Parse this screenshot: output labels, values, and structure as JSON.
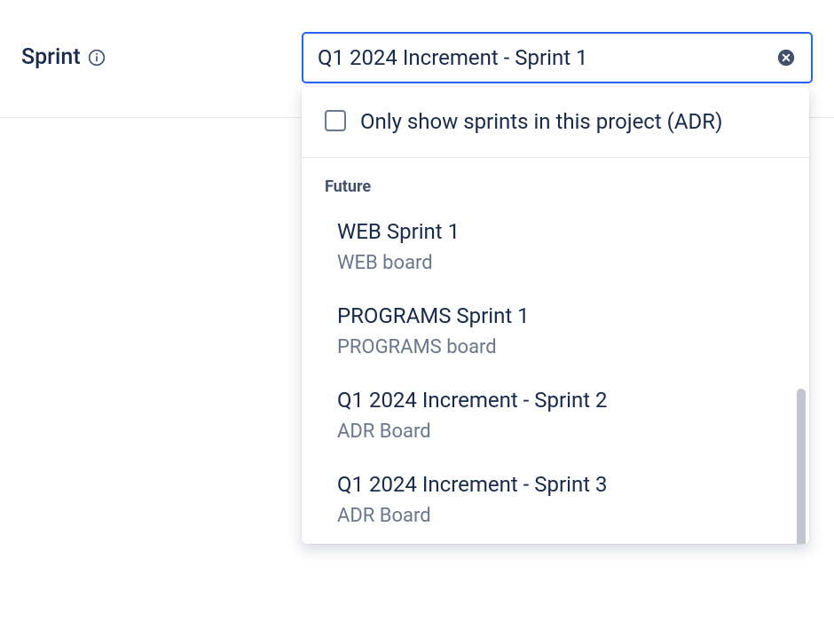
{
  "field": {
    "label": "Sprint",
    "input_value": "Q1 2024 Increment - Sprint 1"
  },
  "dropdown": {
    "filter_label": "Only show sprints in this project (ADR)",
    "section_header": "Future",
    "options": [
      {
        "title": "WEB Sprint 1",
        "subtitle": "WEB board"
      },
      {
        "title": "PROGRAMS Sprint 1",
        "subtitle": "PROGRAMS board"
      },
      {
        "title": "Q1 2024 Increment - Sprint 2",
        "subtitle": "ADR Board"
      },
      {
        "title": "Q1 2024 Increment - Sprint 3",
        "subtitle": "ADR Board"
      }
    ]
  }
}
